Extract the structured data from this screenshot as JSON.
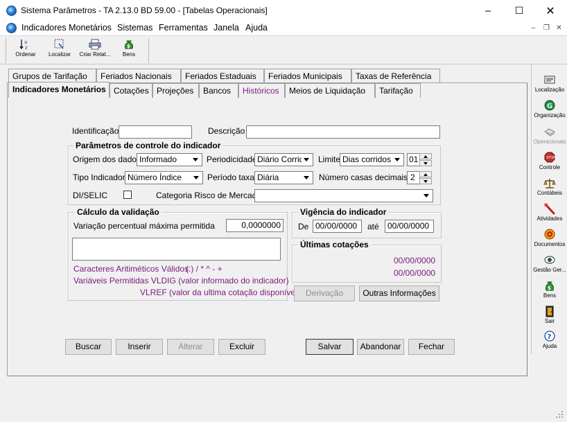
{
  "window": {
    "title": "Sistema Parâmetros -   TA 2.13.0 BD 59.00 - [Tabelas Operacionais]",
    "minimize": "–",
    "maximize": "☐",
    "close": "✕"
  },
  "menu": {
    "items": [
      "Indicadores Monetários",
      "Sistemas",
      "Ferramentas",
      "Janela",
      "Ajuda"
    ],
    "mdi_min": "–",
    "mdi_restore": "❐",
    "mdi_close": "✕"
  },
  "toolbar": {
    "items": [
      "Ordenar",
      "Localizar",
      "Criar Relat...",
      "Bens"
    ]
  },
  "rightbar": {
    "items": [
      "Localização",
      "Organização",
      "Operacionais",
      "Controle",
      "Contábeis",
      "Atividades",
      "Documentos",
      "Gestão Ger...",
      "Bens",
      "Sair",
      "Ajuda"
    ]
  },
  "tabs": {
    "row1": [
      "Grupos de Tarifação",
      "Feriados Nacionais",
      "Feriados Estaduais",
      "Feriados Municipais",
      "Taxas de Referência"
    ],
    "row2": [
      "Indicadores Monetários",
      "Cotações",
      "Projeções",
      "Bancos",
      "Históricos",
      "Meios de Liquidação",
      "Tarifação"
    ]
  },
  "form": {
    "identificacao_label": "Identificação",
    "identificacao_value": "",
    "descricao_label": "Descrição",
    "descricao_value": "",
    "params_group": "Parâmetros de controle do indicador",
    "origem_label": "Origem dos dados",
    "origem_value": "Informado",
    "periodicidade_label": "Periodicidade",
    "periodicidade_value": "Diário Corrido",
    "limite_label": "Limite",
    "limite_value": "Dias corridos",
    "limite_num": "01",
    "tipo_label": "Tipo Indicador",
    "tipo_value": "Número Índice",
    "periodo_label": "Período taxa",
    "periodo_value": "Diária",
    "casas_label": "Número casas decimais",
    "casas_value": "2",
    "diselic_label": "DI/SELIC",
    "categoria_label": "Categoria Risco de Mercado",
    "categoria_value": "",
    "calculo_group": "Cálculo da validação",
    "variacao_label": "Variação percentual máxima permitida",
    "variacao_value": "0,0000000",
    "caract_label": "Caracteres Aritiméticos Válidos:",
    "caract_value": "( ) / * ^ - +",
    "variaveis_label": "Variáveis Permitidas VLDIG  (valor informado do indicador)",
    "vlref_label": "VLREF (valor da ultima cotação disponível)",
    "vigencia_group": "Vigência do indicador",
    "de_label": "De",
    "de_value": "00/00/0000",
    "ate_label": "até",
    "ate_value": "00/00/0000",
    "ultimas_group": "Últimas cotações",
    "cotacao1": "00/00/0000",
    "cotacao2": "00/00/0000"
  },
  "buttons": {
    "derivacao": "Derivação",
    "outras": "Outras Informações",
    "buscar": "Buscar",
    "inserir": "Inserir",
    "alterar": "Alterar",
    "excluir": "Excluir",
    "salvar": "Salvar",
    "abandonar": "Abandonar",
    "fechar": "Fechar"
  }
}
